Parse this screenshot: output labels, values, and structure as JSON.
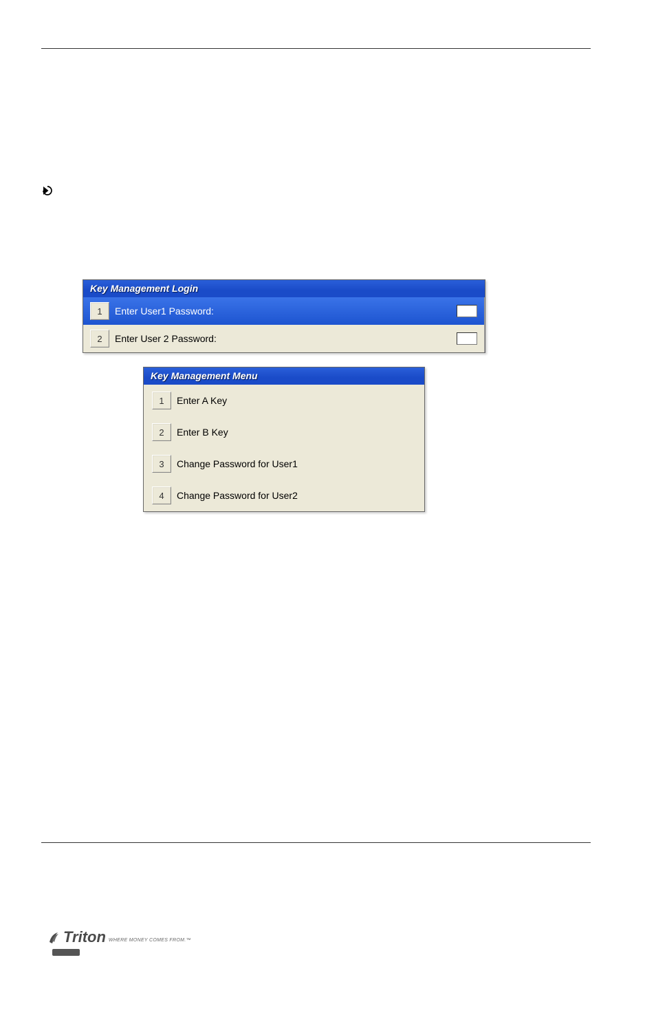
{
  "login_window": {
    "title": "Key Management Login",
    "rows": [
      {
        "num": "1",
        "label": "Enter User1 Password:"
      },
      {
        "num": "2",
        "label": "Enter User 2 Password:"
      }
    ]
  },
  "menu_window": {
    "title": "Key Management Menu",
    "rows": [
      {
        "num": "1",
        "label": "Enter A Key"
      },
      {
        "num": "2",
        "label": "Enter B Key"
      },
      {
        "num": "3",
        "label": "Change Password for User1"
      },
      {
        "num": "4",
        "label": "Change Password for User2"
      }
    ]
  },
  "footer": {
    "brand": "Triton",
    "tagline": "WHERE MONEY COMES FROM.™"
  }
}
